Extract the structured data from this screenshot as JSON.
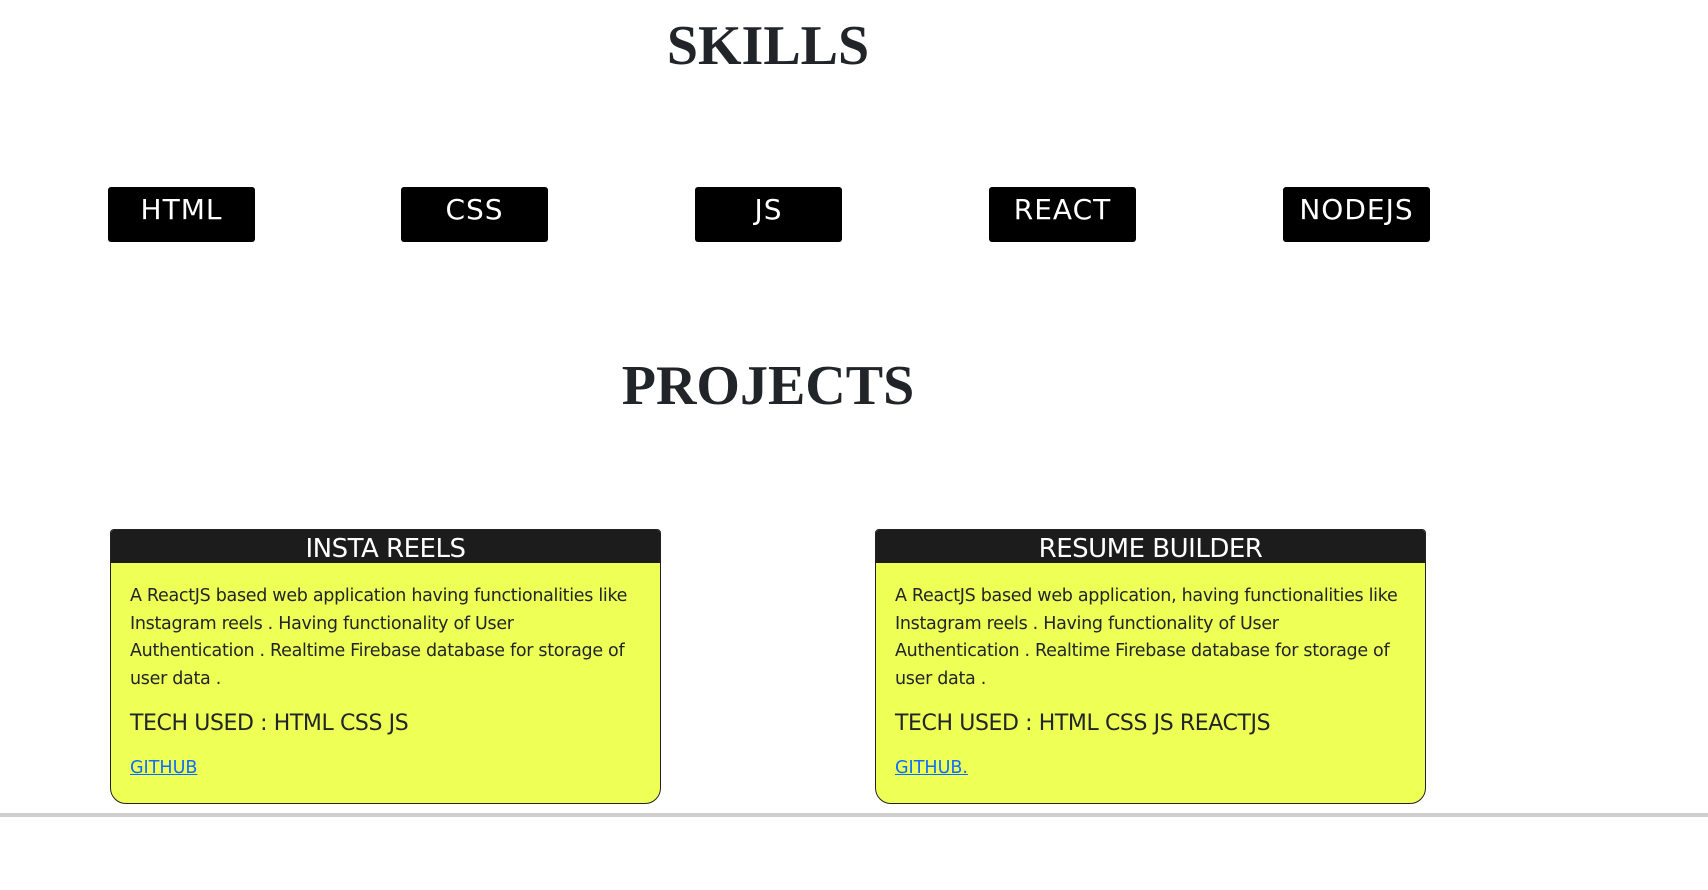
{
  "skills": {
    "title": "SKILLS",
    "items": [
      "HTML",
      "CSS",
      "JS",
      "REACT",
      "NODEJS"
    ]
  },
  "projects": {
    "title": "PROJECTS",
    "items": [
      {
        "name": "INSTA REELS",
        "description": "A ReactJS based web application having functionalities like Instagram reels . Having functionality of User Authentication . Realtime Firebase database for storage of user data .",
        "tech": "TECH USED : HTML CSS JS",
        "link": "GITHUB"
      },
      {
        "name": "RESUME BUILDER",
        "description": "A ReactJS based web application, having functionalities like Instagram reels . Having functionality of User Authentication . Realtime Firebase database for storage of user data .",
        "tech": "TECH USED : HTML CSS JS REACTJS",
        "link": "GITHUB."
      }
    ]
  },
  "colors": {
    "card_background": "#eeff55",
    "card_header": "#1c1c1c",
    "skill_background": "#000000",
    "link": "#0d6efd"
  }
}
